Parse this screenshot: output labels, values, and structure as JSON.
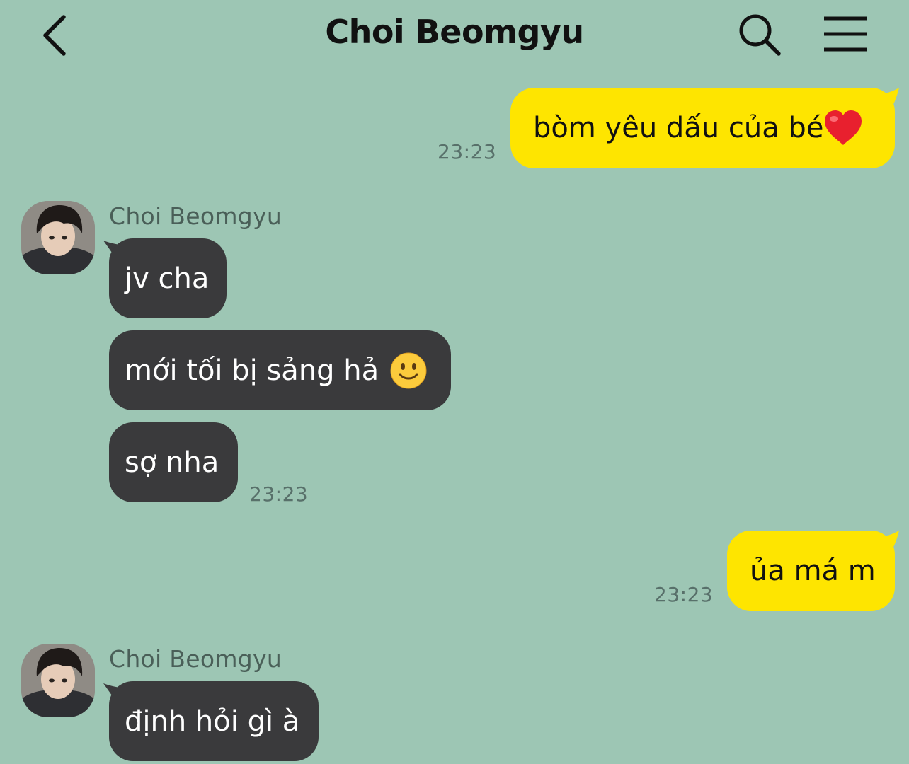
{
  "header": {
    "title": "Choi Beomgyu",
    "back_icon": "chevron-left-icon",
    "search_icon": "search-icon",
    "menu_icon": "hamburger-menu-icon"
  },
  "messages": [
    {
      "from": "me",
      "text": "bòm yêu dấu của bé",
      "emoji": "red-heart",
      "time": "23:23"
    },
    {
      "from": "them",
      "sender": "Choi Beomgyu",
      "text": "jv cha"
    },
    {
      "from": "them",
      "text": "mới tối bị sảng hả",
      "emoji": "slightly-smiling-face"
    },
    {
      "from": "them",
      "text": "sợ nha",
      "time": "23:23"
    },
    {
      "from": "me",
      "text": "ủa má m",
      "time": "23:23"
    },
    {
      "from": "them",
      "sender": "Choi Beomgyu",
      "text": "định hỏi gì à"
    }
  ],
  "colors": {
    "background": "#9dc6b4",
    "my_bubble": "#fee500",
    "their_bubble": "#3a3a3c",
    "timestamp": "#58706a"
  }
}
